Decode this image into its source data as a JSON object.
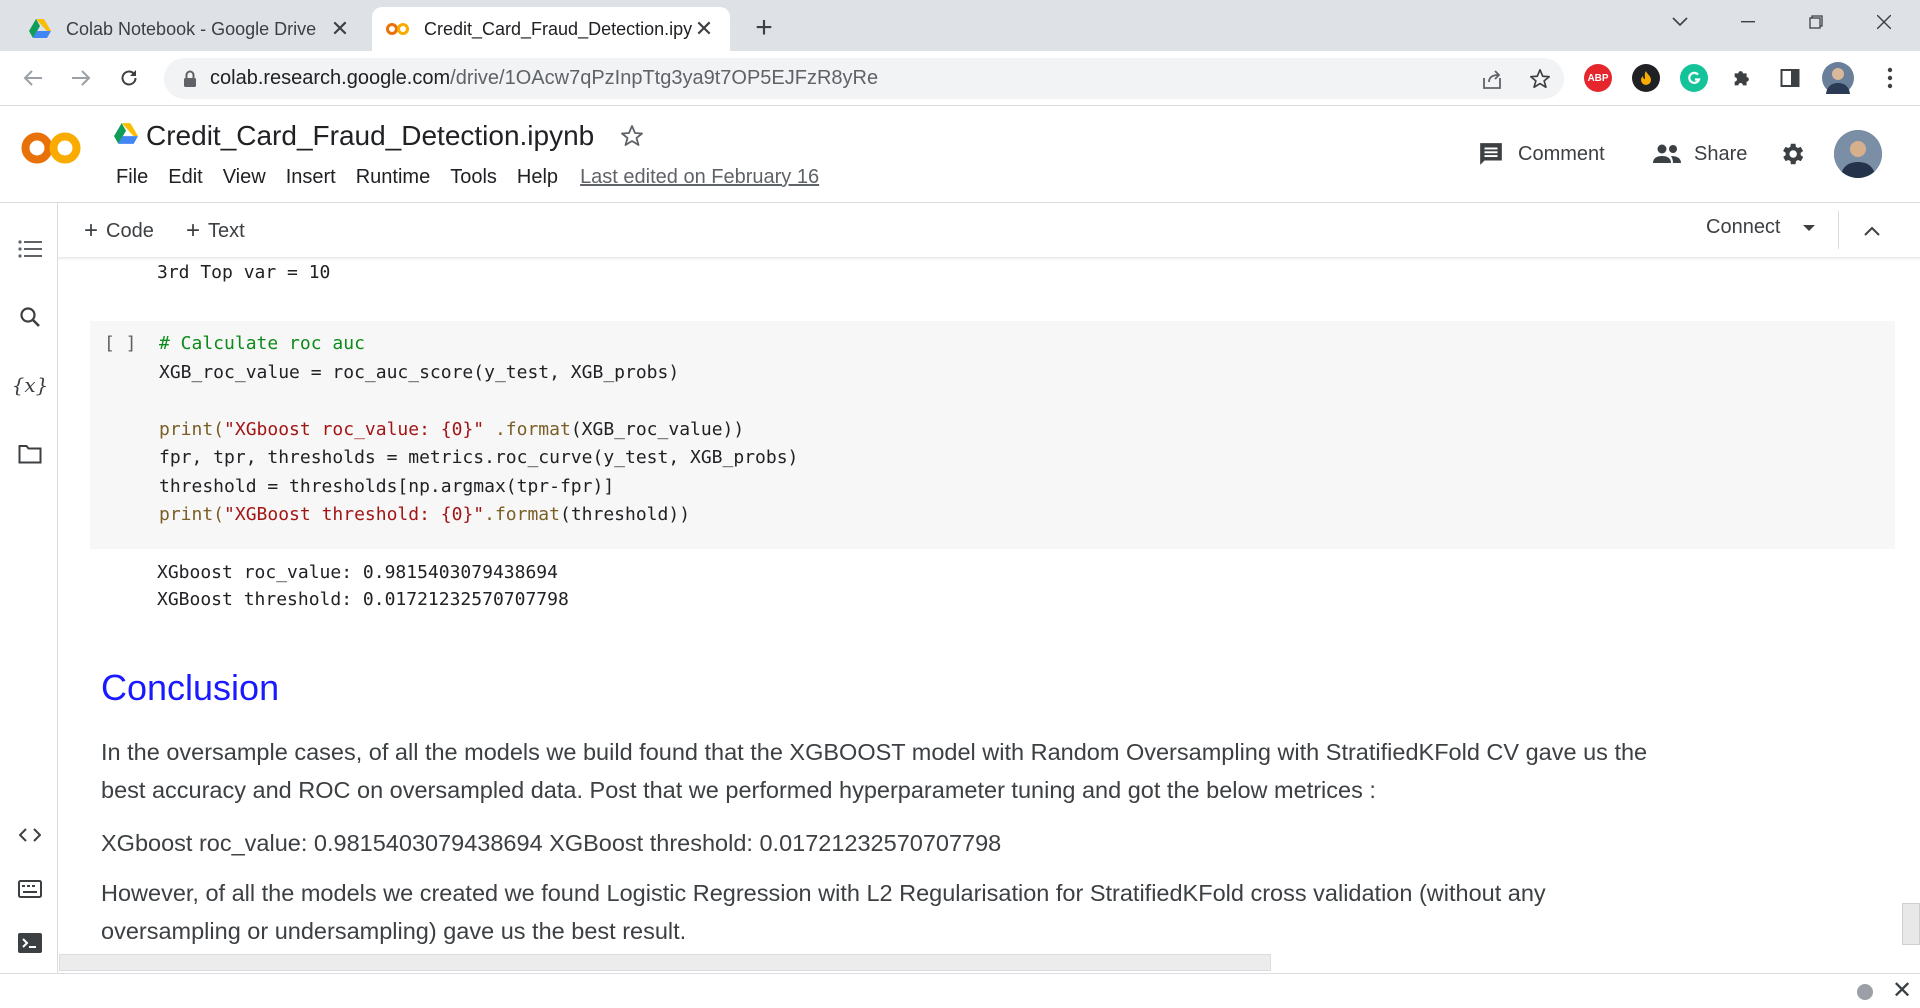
{
  "browser": {
    "tabs": [
      {
        "title": "Colab Notebook - Google Drive",
        "active": false,
        "icon": "google-drive-icon"
      },
      {
        "title": "Credit_Card_Fraud_Detection.ipynb",
        "active": true,
        "icon": "colab-icon"
      }
    ],
    "close_glyph": "✕",
    "new_tab_glyph": "+",
    "url_host": "colab.research.google.com",
    "url_path": "/drive/1OAcw7qPzInpTtg3ya9t7OP5EJFzR8yRe",
    "extensions": [
      "adblock-plus-icon",
      "extension-flame-icon",
      "grammarly-icon",
      "puzzle-icon",
      "side-panel-icon"
    ],
    "abp_label": "ABP"
  },
  "colab": {
    "logo_text": "CO",
    "notebook_title": "Credit_Card_Fraud_Detection.ipynb",
    "menu": [
      "File",
      "Edit",
      "View",
      "Insert",
      "Runtime",
      "Tools",
      "Help"
    ],
    "last_edited": "Last edited on February 16",
    "comment_label": "Comment",
    "share_label": "Share",
    "add_code_label": "Code",
    "add_text_label": "Text",
    "connect_label": "Connect",
    "accent_color": "#f9ab00",
    "brand_orange": "#e8710a"
  },
  "notebook": {
    "previous_output": "3rd Top var = 10",
    "run_bracket": "[ ]",
    "code_lines": {
      "l1_comment": "# Calculate roc auc",
      "l2": "XGB_roc_value = roc_auc_score(y_test, XGB_probs)",
      "l4_print": "print(",
      "l4_str": "\"XGboost roc_value: {0}\"",
      "l4_format": " .format",
      "l4_rest": "(XGB_roc_value))",
      "l5": "fpr, tpr, thresholds = metrics.roc_curve(y_test, XGB_probs)",
      "l6": "threshold = thresholds[np.argmax(tpr-fpr)]",
      "l7_print": "print(",
      "l7_str": "\"XGBoost threshold: {0}\"",
      "l7_format": ".format",
      "l7_rest": "(threshold))"
    },
    "output_lines": [
      "XGboost roc_value: 0.9815403079438694",
      "XGBoost threshold: 0.01721232570707798"
    ],
    "conclusion_heading": "Conclusion",
    "paragraphs": [
      "In the oversample cases, of all the models we build found that the XGBOOST model with Random Oversampling with StratifiedKFold CV gave us the best accuracy and ROC on oversampled data. Post that we performed hyperparameter tuning and got the below metrices :",
      "XGboost roc_value: 0.9815403079438694 XGBoost threshold: 0.01721232570707798",
      "However, of all the models we created we found Logistic Regression with L2 Regularisation for StratifiedKFold cross validation (without any oversampling or undersampling) gave us the best result."
    ]
  }
}
